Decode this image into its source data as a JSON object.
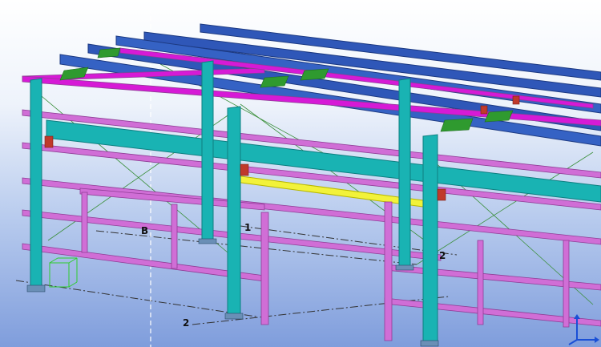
{
  "grid_labels": {
    "b": "B",
    "one": "1",
    "two_right": "2",
    "two_bottom": "2"
  },
  "icons": {
    "axes": "xyz-axes-icon",
    "view_point": "view-rotation-point-icon"
  },
  "colors": {
    "columns": "#19b3b3",
    "column_dark": "#0e7f80",
    "girts_pink": "#d06ed6",
    "girts_pink_dark": "#8e3d95",
    "rafter_magenta": "#d61ad6",
    "purlins_blue": "#2f57b8",
    "purlins_blue_dark": "#1d3a82",
    "connection_plate_green": "#2f9a2f",
    "knee_brace_red": "#c0392b",
    "selected_beam": "#f2f23a",
    "bracing_green": "#3a8f3a"
  }
}
